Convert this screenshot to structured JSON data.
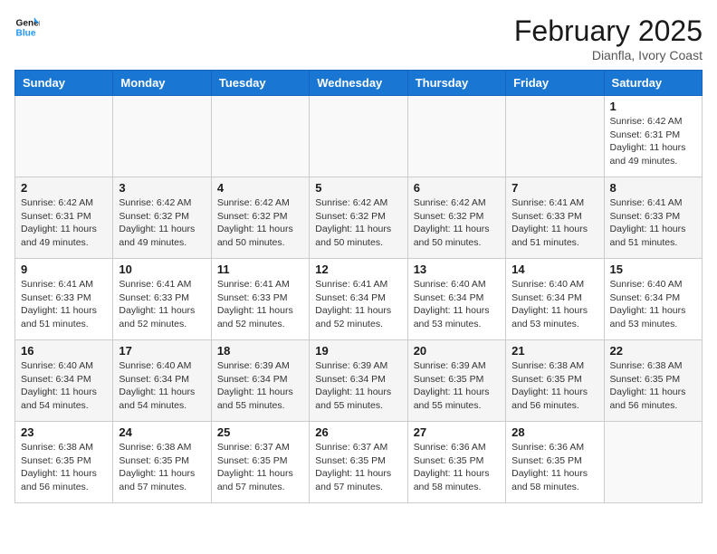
{
  "header": {
    "logo_line1": "General",
    "logo_line2": "Blue",
    "month_title": "February 2025",
    "location": "Dianfla, Ivory Coast"
  },
  "days_of_week": [
    "Sunday",
    "Monday",
    "Tuesday",
    "Wednesday",
    "Thursday",
    "Friday",
    "Saturday"
  ],
  "weeks": [
    {
      "alt": false,
      "days": [
        {
          "num": "",
          "info": ""
        },
        {
          "num": "",
          "info": ""
        },
        {
          "num": "",
          "info": ""
        },
        {
          "num": "",
          "info": ""
        },
        {
          "num": "",
          "info": ""
        },
        {
          "num": "",
          "info": ""
        },
        {
          "num": "1",
          "info": "Sunrise: 6:42 AM\nSunset: 6:31 PM\nDaylight: 11 hours\nand 49 minutes."
        }
      ]
    },
    {
      "alt": true,
      "days": [
        {
          "num": "2",
          "info": "Sunrise: 6:42 AM\nSunset: 6:31 PM\nDaylight: 11 hours\nand 49 minutes."
        },
        {
          "num": "3",
          "info": "Sunrise: 6:42 AM\nSunset: 6:32 PM\nDaylight: 11 hours\nand 49 minutes."
        },
        {
          "num": "4",
          "info": "Sunrise: 6:42 AM\nSunset: 6:32 PM\nDaylight: 11 hours\nand 50 minutes."
        },
        {
          "num": "5",
          "info": "Sunrise: 6:42 AM\nSunset: 6:32 PM\nDaylight: 11 hours\nand 50 minutes."
        },
        {
          "num": "6",
          "info": "Sunrise: 6:42 AM\nSunset: 6:32 PM\nDaylight: 11 hours\nand 50 minutes."
        },
        {
          "num": "7",
          "info": "Sunrise: 6:41 AM\nSunset: 6:33 PM\nDaylight: 11 hours\nand 51 minutes."
        },
        {
          "num": "8",
          "info": "Sunrise: 6:41 AM\nSunset: 6:33 PM\nDaylight: 11 hours\nand 51 minutes."
        }
      ]
    },
    {
      "alt": false,
      "days": [
        {
          "num": "9",
          "info": "Sunrise: 6:41 AM\nSunset: 6:33 PM\nDaylight: 11 hours\nand 51 minutes."
        },
        {
          "num": "10",
          "info": "Sunrise: 6:41 AM\nSunset: 6:33 PM\nDaylight: 11 hours\nand 52 minutes."
        },
        {
          "num": "11",
          "info": "Sunrise: 6:41 AM\nSunset: 6:33 PM\nDaylight: 11 hours\nand 52 minutes."
        },
        {
          "num": "12",
          "info": "Sunrise: 6:41 AM\nSunset: 6:34 PM\nDaylight: 11 hours\nand 52 minutes."
        },
        {
          "num": "13",
          "info": "Sunrise: 6:40 AM\nSunset: 6:34 PM\nDaylight: 11 hours\nand 53 minutes."
        },
        {
          "num": "14",
          "info": "Sunrise: 6:40 AM\nSunset: 6:34 PM\nDaylight: 11 hours\nand 53 minutes."
        },
        {
          "num": "15",
          "info": "Sunrise: 6:40 AM\nSunset: 6:34 PM\nDaylight: 11 hours\nand 53 minutes."
        }
      ]
    },
    {
      "alt": true,
      "days": [
        {
          "num": "16",
          "info": "Sunrise: 6:40 AM\nSunset: 6:34 PM\nDaylight: 11 hours\nand 54 minutes."
        },
        {
          "num": "17",
          "info": "Sunrise: 6:40 AM\nSunset: 6:34 PM\nDaylight: 11 hours\nand 54 minutes."
        },
        {
          "num": "18",
          "info": "Sunrise: 6:39 AM\nSunset: 6:34 PM\nDaylight: 11 hours\nand 55 minutes."
        },
        {
          "num": "19",
          "info": "Sunrise: 6:39 AM\nSunset: 6:34 PM\nDaylight: 11 hours\nand 55 minutes."
        },
        {
          "num": "20",
          "info": "Sunrise: 6:39 AM\nSunset: 6:35 PM\nDaylight: 11 hours\nand 55 minutes."
        },
        {
          "num": "21",
          "info": "Sunrise: 6:38 AM\nSunset: 6:35 PM\nDaylight: 11 hours\nand 56 minutes."
        },
        {
          "num": "22",
          "info": "Sunrise: 6:38 AM\nSunset: 6:35 PM\nDaylight: 11 hours\nand 56 minutes."
        }
      ]
    },
    {
      "alt": false,
      "days": [
        {
          "num": "23",
          "info": "Sunrise: 6:38 AM\nSunset: 6:35 PM\nDaylight: 11 hours\nand 56 minutes."
        },
        {
          "num": "24",
          "info": "Sunrise: 6:38 AM\nSunset: 6:35 PM\nDaylight: 11 hours\nand 57 minutes."
        },
        {
          "num": "25",
          "info": "Sunrise: 6:37 AM\nSunset: 6:35 PM\nDaylight: 11 hours\nand 57 minutes."
        },
        {
          "num": "26",
          "info": "Sunrise: 6:37 AM\nSunset: 6:35 PM\nDaylight: 11 hours\nand 57 minutes."
        },
        {
          "num": "27",
          "info": "Sunrise: 6:36 AM\nSunset: 6:35 PM\nDaylight: 11 hours\nand 58 minutes."
        },
        {
          "num": "28",
          "info": "Sunrise: 6:36 AM\nSunset: 6:35 PM\nDaylight: 11 hours\nand 58 minutes."
        },
        {
          "num": "",
          "info": ""
        }
      ]
    }
  ]
}
